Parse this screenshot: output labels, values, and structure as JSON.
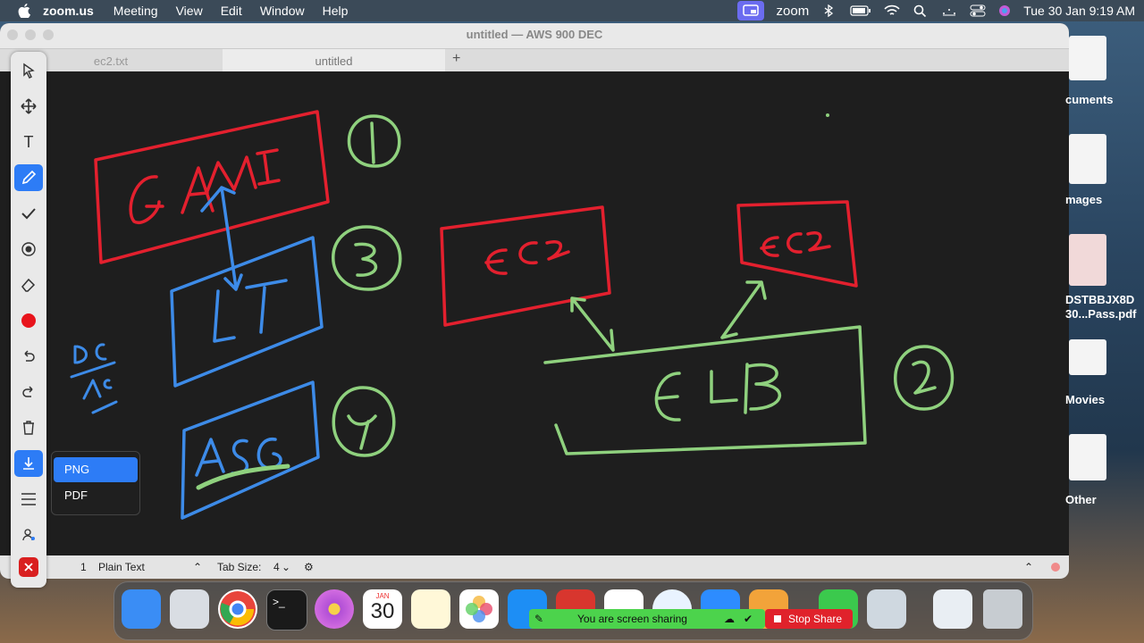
{
  "menubar": {
    "app": "zoom.us",
    "items": [
      "Meeting",
      "View",
      "Edit",
      "Window",
      "Help"
    ],
    "zoom_label": "zoom",
    "clock": "Tue 30 Jan  9:19 AM"
  },
  "window": {
    "title": "untitled — AWS 900 DEC",
    "tabs": [
      "ec2.txt",
      "untitled"
    ],
    "plus": "+"
  },
  "statusbar": {
    "line": "1",
    "syntax": "Plain Text",
    "tab_size_label": "Tab Size:",
    "tab_size": "4"
  },
  "export_menu": {
    "options": [
      "PNG",
      "PDF"
    ],
    "selected": "PNG"
  },
  "whiteboard": {
    "labels": [
      "AMI",
      "LT",
      "ASG",
      "EC2",
      "EC2",
      "ELB"
    ],
    "numbers": [
      "1",
      "3",
      "4",
      "2"
    ],
    "side_note": [
      "DC",
      "AC"
    ],
    "colors": {
      "red": "#e3202e",
      "blue": "#3d8be8",
      "green": "#8fd17e"
    }
  },
  "desktop_icons": [
    "cuments",
    "mages",
    "DSTBBJX8D",
    "30...Pass.pdf",
    "Movies",
    "Other"
  ],
  "dock": {
    "calendar_month": "JAN",
    "calendar_day": "30",
    "sharing_text": "You are screen sharing",
    "stop_share": "Stop Share"
  }
}
